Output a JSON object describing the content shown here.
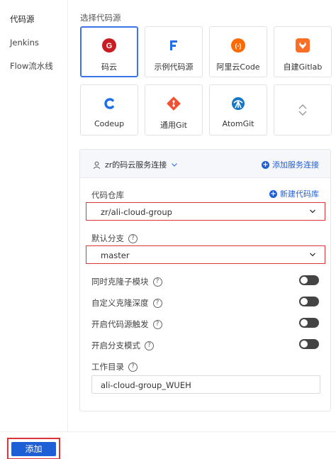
{
  "sidebar": {
    "items": [
      {
        "label": "代码源"
      },
      {
        "label": "Jenkins"
      },
      {
        "label": "Flow流水线"
      }
    ]
  },
  "main": {
    "section_label": "选择代码源",
    "sources": [
      {
        "label": "码云",
        "icon": "gitee-icon",
        "color": "#c71d23"
      },
      {
        "label": "示例代码源",
        "icon": "flow-f-icon",
        "color": "#1f6feb"
      },
      {
        "label": "阿里云Code",
        "icon": "aliyun-code-icon",
        "color": "#ff6a00"
      },
      {
        "label": "自建Gitlab",
        "icon": "gitlab-icon",
        "color": "#fc6d26"
      },
      {
        "label": "Codeup",
        "icon": "codeup-icon",
        "color": "#1f6feb"
      },
      {
        "label": "通用Git",
        "icon": "git-icon",
        "color": "#f05133"
      },
      {
        "label": "AtomGit",
        "icon": "atomgit-icon",
        "color": "#1677c7"
      }
    ]
  },
  "panel": {
    "connection": "zr的码云服务连接",
    "add_connection": "添加服务连接",
    "repo_label": "代码仓库",
    "new_repo": "新建代码库",
    "repo_value": "zr/ali-cloud-group",
    "branch_label": "默认分支",
    "branch_value": "master",
    "toggles": [
      {
        "label": "同时克隆子模块"
      },
      {
        "label": "自定义克隆深度"
      },
      {
        "label": "开启代码源触发"
      },
      {
        "label": "开启分支模式"
      }
    ],
    "workdir_label": "工作目录",
    "workdir_value": "ali-cloud-group_WUEH"
  },
  "footer": {
    "add_label": "添加"
  }
}
